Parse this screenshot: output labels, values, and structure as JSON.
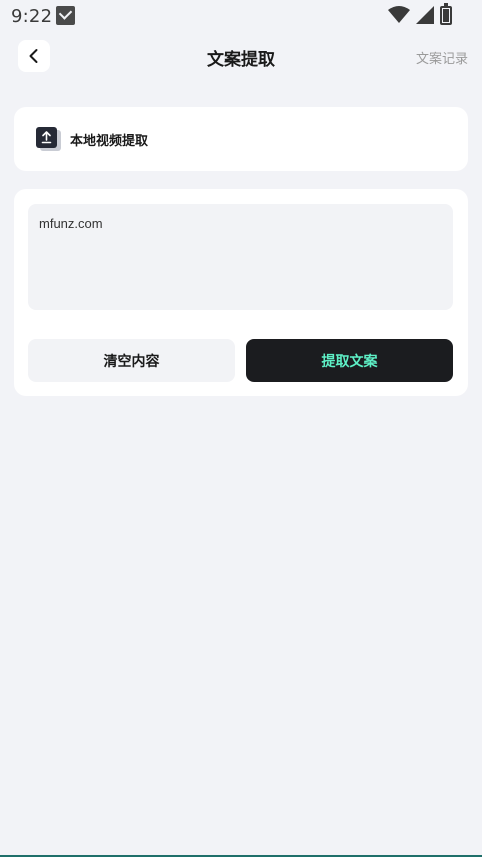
{
  "status_bar": {
    "time": "9:22",
    "icons": [
      "mail-icon",
      "wifi-icon",
      "signal-icon",
      "battery-icon"
    ]
  },
  "header": {
    "back_icon": "chevron-left-icon",
    "title": "文案提取",
    "history_link": "文案记录"
  },
  "upload": {
    "icon": "upload-icon",
    "label": "本地视频提取"
  },
  "input": {
    "value": "mfunz.com"
  },
  "actions": {
    "clear_label": "清空内容",
    "extract_label": "提取文案"
  },
  "colors": {
    "background": "#f2f3f7",
    "card": "#ffffff",
    "primary_button": "#1b1c1f",
    "primary_button_text": "#5ef0c6",
    "muted_text": "#9a9a9a"
  }
}
